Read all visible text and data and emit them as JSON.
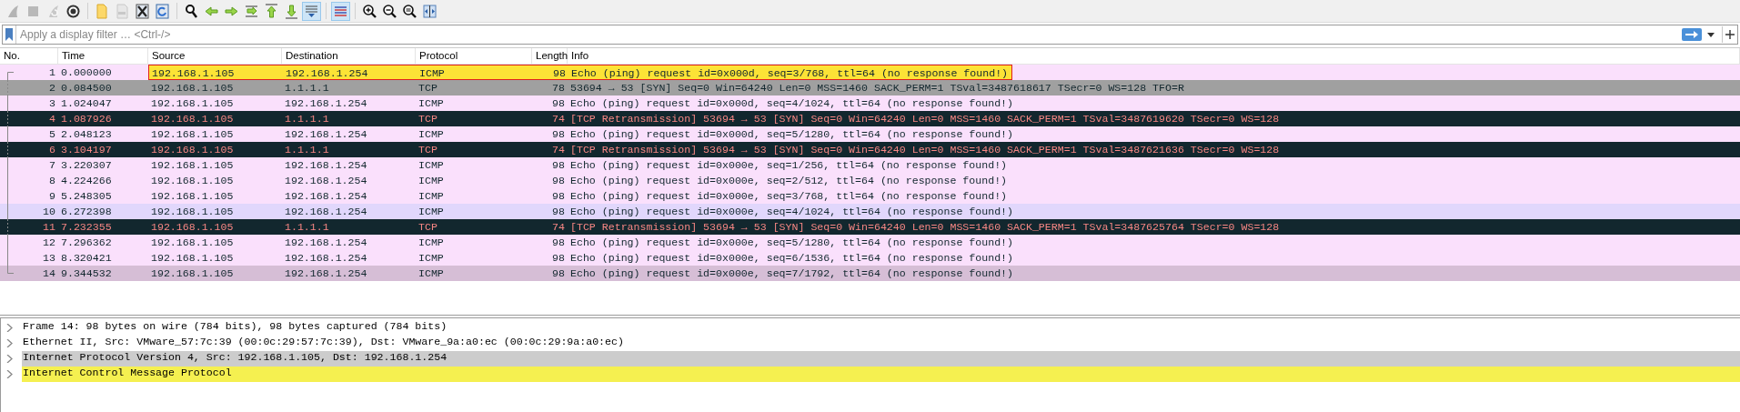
{
  "toolbar": [
    {
      "kind": "fin",
      "disabled": true,
      "pressed": false
    },
    {
      "kind": "stop",
      "disabled": true,
      "pressed": false
    },
    {
      "kind": "restart",
      "disabled": true,
      "pressed": false
    },
    {
      "kind": "gear",
      "disabled": false,
      "pressed": false
    },
    {
      "kind": "sep"
    },
    {
      "kind": "folder",
      "disabled": false,
      "pressed": false
    },
    {
      "kind": "file",
      "disabled": true,
      "pressed": false
    },
    {
      "kind": "close",
      "disabled": false,
      "pressed": false
    },
    {
      "kind": "reload",
      "disabled": false,
      "pressed": false
    },
    {
      "kind": "sep"
    },
    {
      "kind": "find",
      "disabled": false,
      "pressed": false
    },
    {
      "kind": "back",
      "disabled": false,
      "pressed": false
    },
    {
      "kind": "forward",
      "disabled": false,
      "pressed": false
    },
    {
      "kind": "goto",
      "disabled": false,
      "pressed": false
    },
    {
      "kind": "first",
      "disabled": false,
      "pressed": false
    },
    {
      "kind": "last",
      "disabled": false,
      "pressed": false
    },
    {
      "kind": "autoscroll",
      "disabled": false,
      "pressed": true
    },
    {
      "kind": "sep"
    },
    {
      "kind": "colorize",
      "disabled": false,
      "pressed": true
    },
    {
      "kind": "sep"
    },
    {
      "kind": "zoomin",
      "disabled": false,
      "pressed": false
    },
    {
      "kind": "zoomout",
      "disabled": false,
      "pressed": false
    },
    {
      "kind": "zoomreset",
      "disabled": false,
      "pressed": false
    },
    {
      "kind": "resize",
      "disabled": false,
      "pressed": false
    }
  ],
  "filter": {
    "placeholder": "Apply a display filter … <Ctrl-/>"
  },
  "table": {
    "columns": [
      "No.",
      "Time",
      "Source",
      "Destination",
      "Protocol",
      "Length",
      "Info"
    ],
    "rows": [
      {
        "kind": "icmp",
        "selected": false,
        "highlighted": true,
        "hovered": false,
        "cells": [
          "1",
          "0.000000",
          "192.168.1.105",
          "192.168.1.254",
          "ICMP",
          "98",
          "Echo (ping) request  id=0x000d, seq=3/768, ttl=64 (no response found!)"
        ]
      },
      {
        "kind": "tcp",
        "selected": false,
        "highlighted": false,
        "hovered": false,
        "cells": [
          "2",
          "0.084500",
          "192.168.1.105",
          "1.1.1.1",
          "TCP",
          "78",
          "53694 → 53 [SYN] Seq=0 Win=64240 Len=0 MSS=1460 SACK_PERM=1 TSval=3487618617 TSecr=0 WS=128 TFO=R"
        ]
      },
      {
        "kind": "icmp",
        "selected": false,
        "highlighted": false,
        "hovered": false,
        "cells": [
          "3",
          "1.024047",
          "192.168.1.105",
          "192.168.1.254",
          "ICMP",
          "98",
          "Echo (ping) request  id=0x000d, seq=4/1024, ttl=64 (no response found!)"
        ]
      },
      {
        "kind": "retransmission",
        "selected": false,
        "highlighted": false,
        "hovered": false,
        "cells": [
          "4",
          "1.087926",
          "192.168.1.105",
          "1.1.1.1",
          "TCP",
          "74",
          "[TCP Retransmission] 53694 → 53 [SYN] Seq=0 Win=64240 Len=0 MSS=1460 SACK_PERM=1 TSval=3487619620 TSecr=0 WS=128"
        ]
      },
      {
        "kind": "icmp",
        "selected": false,
        "highlighted": false,
        "hovered": false,
        "cells": [
          "5",
          "2.048123",
          "192.168.1.105",
          "192.168.1.254",
          "ICMP",
          "98",
          "Echo (ping) request  id=0x000d, seq=5/1280, ttl=64 (no response found!)"
        ]
      },
      {
        "kind": "retransmission",
        "selected": false,
        "highlighted": false,
        "hovered": false,
        "cells": [
          "6",
          "3.104197",
          "192.168.1.105",
          "1.1.1.1",
          "TCP",
          "74",
          "[TCP Retransmission] 53694 → 53 [SYN] Seq=0 Win=64240 Len=0 MSS=1460 SACK_PERM=1 TSval=3487621636 TSecr=0 WS=128"
        ]
      },
      {
        "kind": "icmp",
        "selected": false,
        "highlighted": false,
        "hovered": false,
        "cells": [
          "7",
          "3.220307",
          "192.168.1.105",
          "192.168.1.254",
          "ICMP",
          "98",
          "Echo (ping) request  id=0x000e, seq=1/256, ttl=64 (no response found!)"
        ]
      },
      {
        "kind": "icmp",
        "selected": false,
        "highlighted": false,
        "hovered": false,
        "cells": [
          "8",
          "4.224266",
          "192.168.1.105",
          "192.168.1.254",
          "ICMP",
          "98",
          "Echo (ping) request  id=0x000e, seq=2/512, ttl=64 (no response found!)"
        ]
      },
      {
        "kind": "icmp",
        "selected": false,
        "highlighted": false,
        "hovered": false,
        "cells": [
          "9",
          "5.248305",
          "192.168.1.105",
          "192.168.1.254",
          "ICMP",
          "98",
          "Echo (ping) request  id=0x000e, seq=3/768, ttl=64 (no response found!)"
        ]
      },
      {
        "kind": "icmp",
        "selected": false,
        "highlighted": false,
        "hovered": true,
        "cells": [
          "10",
          "6.272398",
          "192.168.1.105",
          "192.168.1.254",
          "ICMP",
          "98",
          "Echo (ping) request  id=0x000e, seq=4/1024, ttl=64 (no response found!)"
        ]
      },
      {
        "kind": "retransmission",
        "selected": false,
        "highlighted": false,
        "hovered": false,
        "cells": [
          "11",
          "7.232355",
          "192.168.1.105",
          "1.1.1.1",
          "TCP",
          "74",
          "[TCP Retransmission] 53694 → 53 [SYN] Seq=0 Win=64240 Len=0 MSS=1460 SACK_PERM=1 TSval=3487625764 TSecr=0 WS=128"
        ]
      },
      {
        "kind": "icmp",
        "selected": false,
        "highlighted": false,
        "hovered": false,
        "cells": [
          "12",
          "7.296362",
          "192.168.1.105",
          "192.168.1.254",
          "ICMP",
          "98",
          "Echo (ping) request  id=0x000e, seq=5/1280, ttl=64 (no response found!)"
        ]
      },
      {
        "kind": "icmp",
        "selected": false,
        "highlighted": false,
        "hovered": false,
        "cells": [
          "13",
          "8.320421",
          "192.168.1.105",
          "192.168.1.254",
          "ICMP",
          "98",
          "Echo (ping) request  id=0x000e, seq=6/1536, ttl=64 (no response found!)"
        ]
      },
      {
        "kind": "icmp",
        "selected": true,
        "highlighted": false,
        "hovered": false,
        "cells": [
          "14",
          "9.344532",
          "192.168.1.105",
          "192.168.1.254",
          "ICMP",
          "98",
          "Echo (ping) request  id=0x000e, seq=7/1792, ttl=64 (no response found!)"
        ]
      }
    ]
  },
  "details": [
    {
      "text": "Frame 14: 98 bytes on wire (784 bits), 98 bytes captured (784 bits)",
      "expanded": false,
      "selected": false,
      "hovered": false
    },
    {
      "text": "Ethernet II, Src: VMware_57:7c:39 (00:0c:29:57:7c:39), Dst: VMware_9a:a0:ec (00:0c:29:9a:a0:ec)",
      "expanded": false,
      "selected": false,
      "hovered": false
    },
    {
      "text": "Internet Protocol Version 4, Src: 192.168.1.105, Dst: 192.168.1.254",
      "expanded": false,
      "selected": false,
      "hovered": true
    },
    {
      "text": "Internet Control Message Protocol",
      "expanded": false,
      "selected": true,
      "hovered": false
    }
  ]
}
